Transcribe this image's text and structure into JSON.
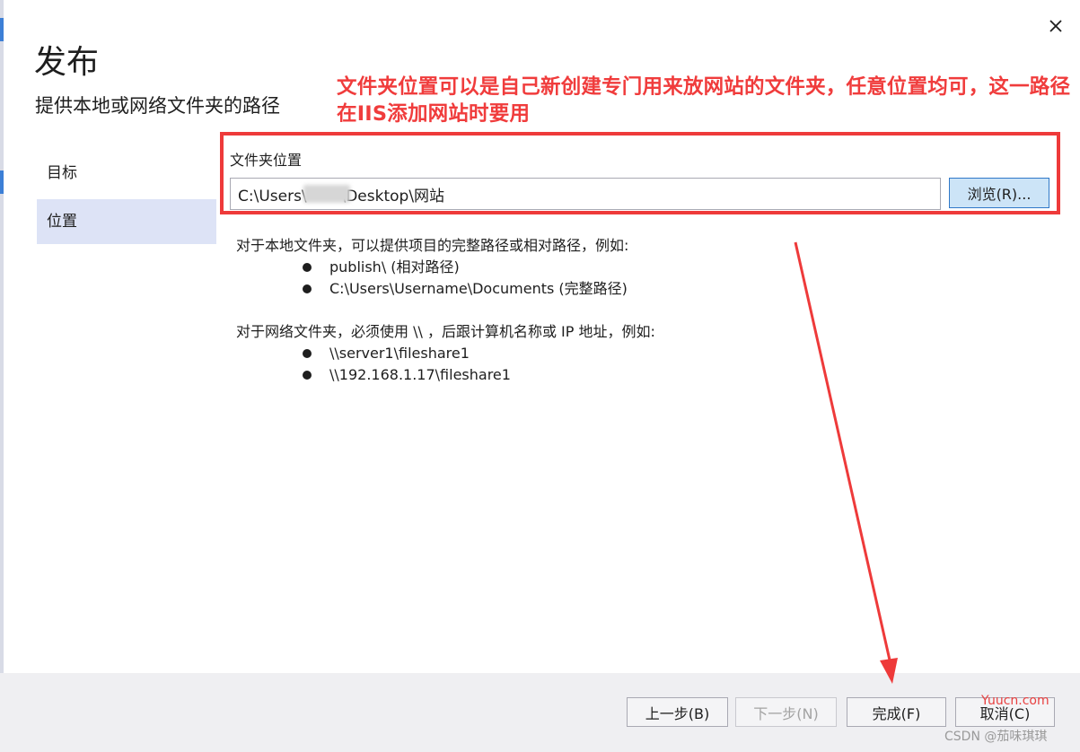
{
  "window": {
    "title": "发布",
    "subtitle": "提供本地或网络文件夹的路径",
    "close_glyph": "✕"
  },
  "sidebar": {
    "items": [
      {
        "label": "目标"
      },
      {
        "label": "位置"
      }
    ]
  },
  "annotation": {
    "text": "文件夹位置可以是自己新创建专门用来放网站的文件夹，任意位置均可，这一路径在IIS添加网站时要用"
  },
  "folder": {
    "label": "文件夹位置",
    "value": "C:\\Users\\       \\Desktop\\网站",
    "browse_label": "浏览(R)..."
  },
  "help": {
    "local_intro": "对于本地文件夹，可以提供项目的完整路径或相对路径，例如:",
    "local_examples": [
      "publish\\ (相对路径)",
      "C:\\Users\\Username\\Documents (完整路径)"
    ],
    "network_intro": "对于网络文件夹，必须使用 \\\\ ，后跟计算机名称或 IP 地址，例如:",
    "network_examples": [
      "\\\\server1\\fileshare1",
      "\\\\192.168.1.17\\fileshare1"
    ]
  },
  "footer": {
    "prev_label": "上一步(B)",
    "next_label": "下一步(N)",
    "finish_label": "完成(F)",
    "cancel_label": "取消(C)"
  },
  "watermarks": {
    "site": "Yuucn.com",
    "author": "CSDN @茄味琪琪"
  },
  "colors": {
    "annotation": "#f03c3c",
    "selected_nav": "#dde3f6",
    "browse_button": "#cce4f7"
  }
}
